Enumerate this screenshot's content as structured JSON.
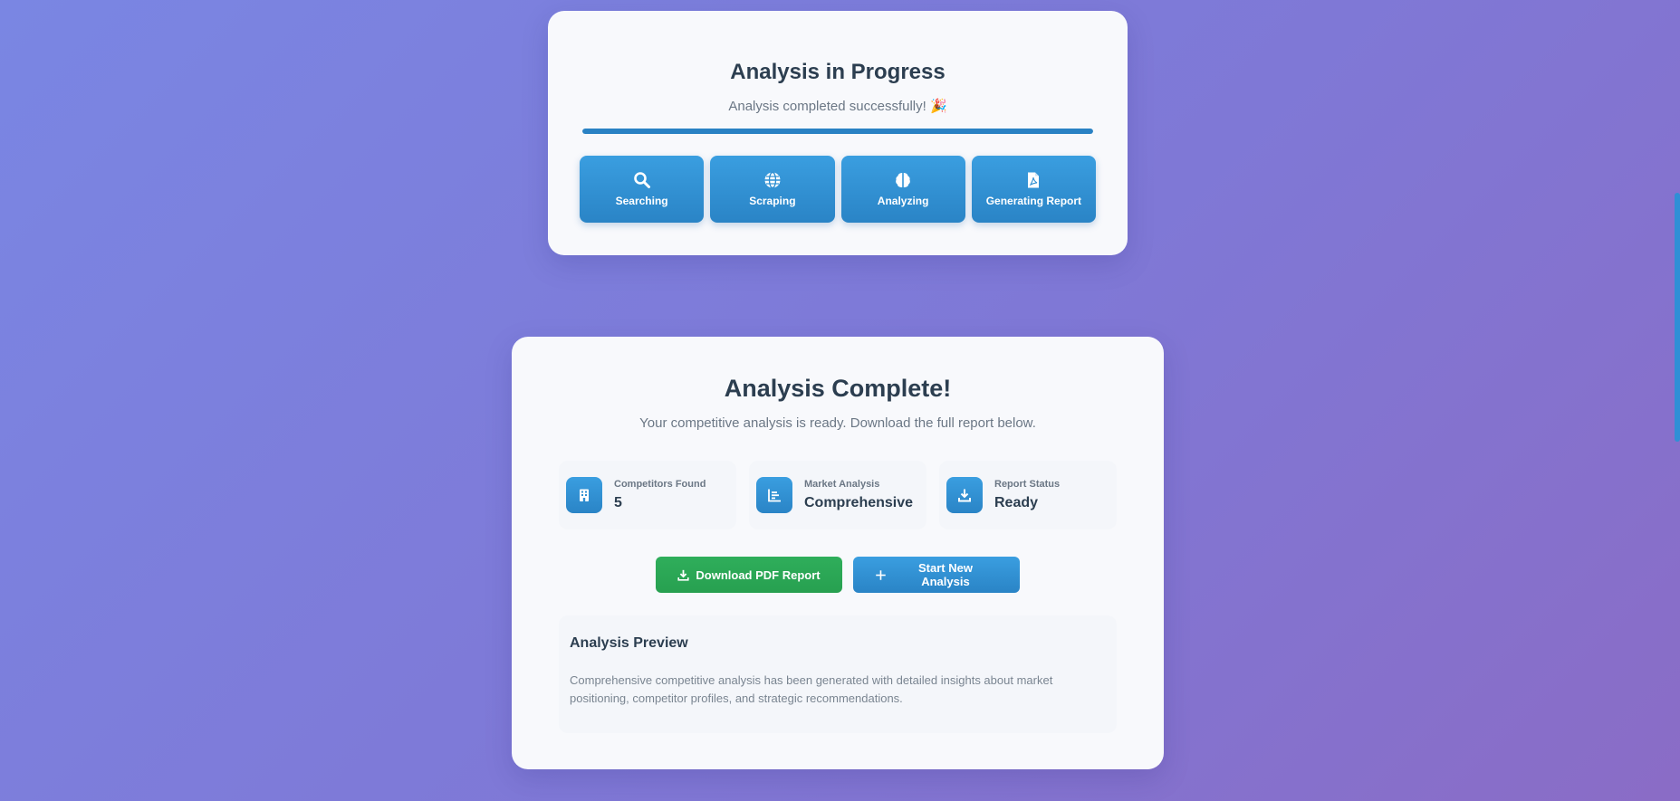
{
  "progress": {
    "title": "Analysis in Progress",
    "status": "Analysis completed successfully! 🎉",
    "percent": 100,
    "steps": [
      {
        "label": "Searching",
        "icon": "search-icon"
      },
      {
        "label": "Scraping",
        "icon": "globe-icon"
      },
      {
        "label": "Analyzing",
        "icon": "brain-icon"
      },
      {
        "label": "Generating Report",
        "icon": "file-pdf-icon"
      }
    ]
  },
  "complete": {
    "title": "Analysis Complete!",
    "subtitle": "Your competitive analysis is ready. Download the full report below.",
    "stats": [
      {
        "label": "Competitors Found",
        "value": "5",
        "icon": "building-icon"
      },
      {
        "label": "Market Analysis",
        "value": "Comprehensive",
        "icon": "chart-icon"
      },
      {
        "label": "Report Status",
        "value": "Ready",
        "icon": "download-icon"
      }
    ],
    "actions": {
      "download_label": "Download PDF Report",
      "new_label": "Start New Analysis"
    },
    "preview": {
      "title": "Analysis Preview",
      "text": "Comprehensive competitive analysis has been generated with detailed insights about market positioning, competitor profiles, and strategic recommendations."
    }
  },
  "colors": {
    "accent": "#2a84c6",
    "success": "#27a050",
    "heading": "#2c3e50"
  }
}
